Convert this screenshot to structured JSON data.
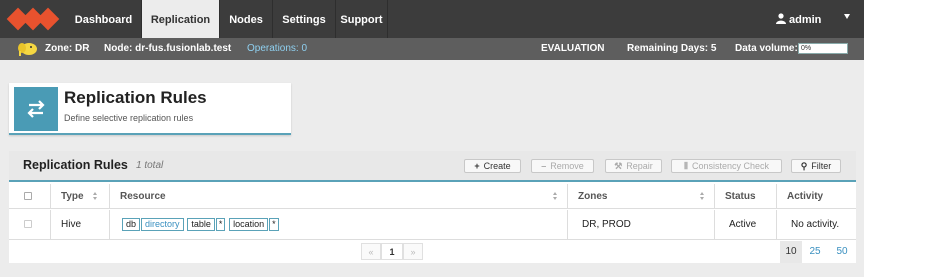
{
  "nav": {
    "items": [
      "Dashboard",
      "Replication",
      "Nodes",
      "Settings",
      "Support"
    ],
    "active": "Replication",
    "user": "admin"
  },
  "status": {
    "zone": "Zone: DR",
    "node": "Node: dr-fus.fusionlab.test",
    "operations": "Operations: 0",
    "license": "EVALUATION",
    "remaining": "Remaining Days: 5",
    "volume_label": "Data volume:",
    "volume_value": "0%"
  },
  "page": {
    "title": "Replication Rules",
    "subtitle": "Define selective replication rules"
  },
  "panel": {
    "title": "Replication Rules",
    "total": "1 total",
    "buttons": {
      "create": "Create",
      "remove": "Remove",
      "repair": "Repair",
      "consistency": "Consistency Check",
      "filter": "Filter"
    }
  },
  "table": {
    "columns": [
      "Type",
      "Resource",
      "Zones",
      "Status",
      "Activity"
    ],
    "rows": [
      {
        "type": "Hive",
        "resource": {
          "db": "db",
          "db_value": "directory",
          "table": "table",
          "table_value": "*",
          "location": "location",
          "location_value": "*"
        },
        "zones": "DR, PROD",
        "status": "Active",
        "activity": "No activity."
      }
    ]
  },
  "pagination": {
    "prev": "«",
    "current": "1",
    "next": "»",
    "sizes": [
      "10",
      "25",
      "50"
    ],
    "selected_size": "10"
  },
  "colors": {
    "accent": "#4a9bb5",
    "brand": "#e8522e",
    "nav_bg": "#3c3c3c",
    "status_bg": "#5e5e5e"
  }
}
